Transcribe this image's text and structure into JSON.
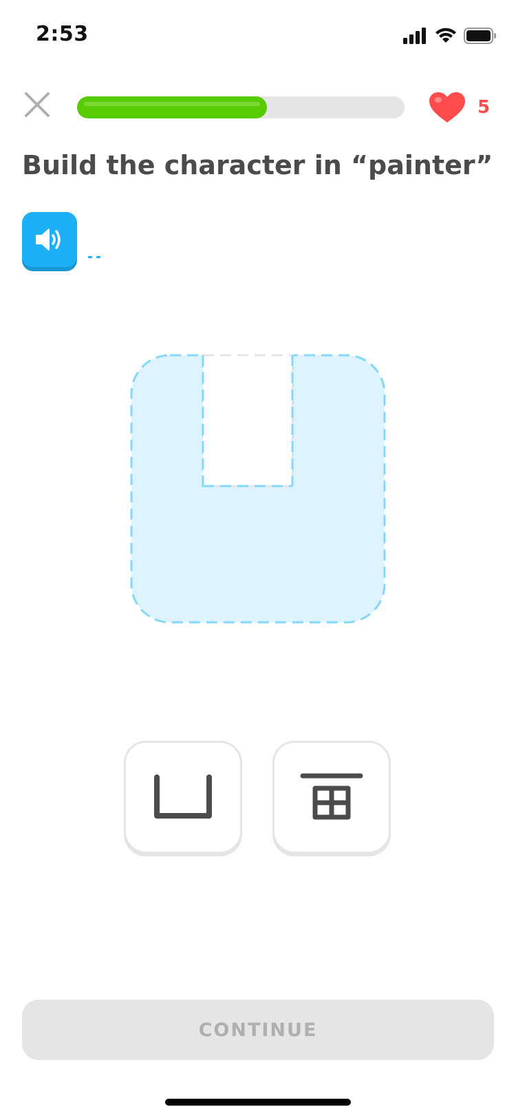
{
  "status_bar": {
    "time": "2:53",
    "signal_icon": "cellular-signal-icon",
    "wifi_icon": "wifi-icon",
    "battery_icon": "battery-icon"
  },
  "header": {
    "close_icon": "close-icon",
    "progress": 0.58,
    "progress_color": "#58cc02",
    "track_color": "#e5e5e5",
    "heart_icon": "heart-icon",
    "hearts_count": "5",
    "hearts_color": "#ff4b4b"
  },
  "prompt": {
    "title": "Build the character in “painter”"
  },
  "audio": {
    "icon": "speaker-icon",
    "color": "#1cb0f6"
  },
  "board": {
    "fill_color": "#ddf4ff",
    "border_color": "#84d8ff",
    "empty_slot_color": "#e5e5e5"
  },
  "tiles": [
    {
      "component": "凵",
      "icon": "radical-open-box-icon"
    },
    {
      "component": "画-inner",
      "icon": "radical-field-icon"
    }
  ],
  "footer": {
    "continue_label": "CONTINUE",
    "disabled_bg": "#e5e5e5",
    "disabled_text": "#afafaf"
  }
}
